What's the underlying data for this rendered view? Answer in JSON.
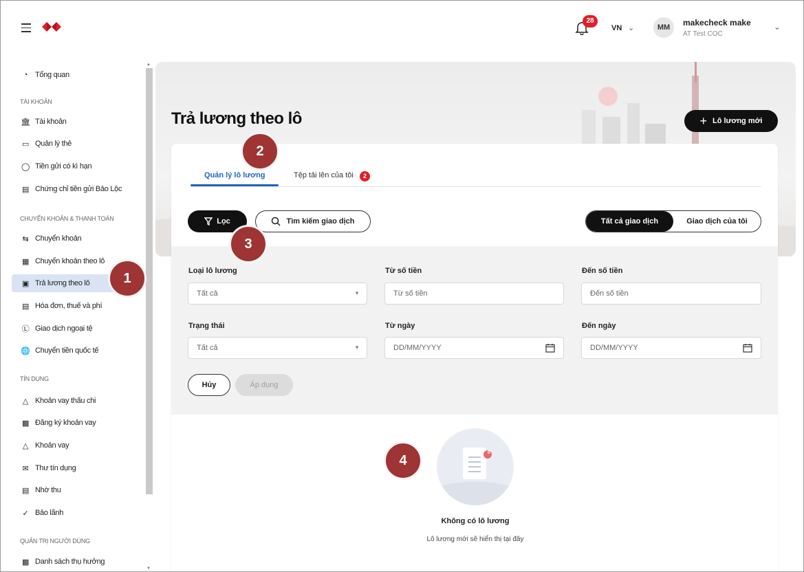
{
  "header": {
    "notifications_count": "28",
    "language": "VN",
    "avatar_initials": "MM",
    "user_name": "makecheck make",
    "user_org": "AT Test COC"
  },
  "sidebar": {
    "items": [
      {
        "label": "Tổng quan",
        "icon": "pie-chart-icon"
      },
      {
        "section": "TÀI KHOẢN"
      },
      {
        "label": "Tài khoản",
        "icon": "bank-icon"
      },
      {
        "label": "Quản lý thẻ",
        "icon": "card-icon"
      },
      {
        "label": "Tiền gửi có kì hạn",
        "icon": "piggy-icon"
      },
      {
        "label": "Chứng chỉ tiền gửi Bảo Lộc",
        "icon": "certificate-icon"
      },
      {
        "section": "CHUYỂN KHOẢN & THANH TOÁN"
      },
      {
        "label": "Chuyển khoản",
        "icon": "transfer-icon"
      },
      {
        "label": "Chuyển khoản theo lô",
        "icon": "table-icon"
      },
      {
        "label": "Trả lương theo lô",
        "icon": "calendar-icon",
        "active": true
      },
      {
        "label": "Hóa đơn, thuế và phí",
        "icon": "bill-icon"
      },
      {
        "label": "Giao dịch ngoại tệ",
        "icon": "fx-icon"
      },
      {
        "label": "Chuyển tiền quốc tế",
        "icon": "globe-icon"
      },
      {
        "section": "TÍN DỤNG"
      },
      {
        "label": "Khoản vay thấu chi",
        "icon": "money-bag-icon"
      },
      {
        "label": "Đăng ký khoản vay",
        "icon": "loan-register-icon"
      },
      {
        "label": "Khoản vay",
        "icon": "loan-icon"
      },
      {
        "label": "Thư tín dụng",
        "icon": "letter-icon"
      },
      {
        "label": "Nhờ thu",
        "icon": "collection-icon"
      },
      {
        "label": "Bảo lãnh",
        "icon": "guarantee-icon"
      },
      {
        "section": "QUẢN TRỊ NGƯỜI DÙNG"
      },
      {
        "label": "Danh sách thụ hưởng",
        "icon": "beneficiary-icon"
      }
    ]
  },
  "main": {
    "title": "Trả lương theo lô",
    "new_batch_label": "Lô lương mới",
    "tabs": [
      {
        "label": "Quản lý lô lương"
      },
      {
        "label": "Tệp tải lên của tôi",
        "badge": "2"
      }
    ],
    "filter_label": "Lọc",
    "search_label": "Tìm kiếm giao dịch",
    "segments": [
      "Tất cả giao dịch",
      "Giao dịch của tôi"
    ],
    "filters": {
      "batch_type_label": "Loại lô lương",
      "batch_type_value": "Tất cả",
      "from_amount_label": "Từ số tiền",
      "from_amount_placeholder": "Từ số tiền",
      "to_amount_label": "Đến số tiền",
      "to_amount_placeholder": "Đến số tiền",
      "status_label": "Trạng thái",
      "status_value": "Tất cả",
      "from_date_label": "Từ ngày",
      "from_date_placeholder": "DD/MM/YYYY",
      "to_date_label": "Đến ngày",
      "to_date_placeholder": "DD/MM/YYYY",
      "cancel_label": "Hủy",
      "apply_label": "Áp dụng"
    },
    "empty": {
      "badge": "0",
      "title": "Không có lô lương",
      "subtitle": "Lô lương mới sẽ hiển thị tại đây"
    }
  },
  "callouts": [
    "1",
    "2",
    "3",
    "4"
  ],
  "colors": {
    "accent": "#1f63c6",
    "brand_red": "#e01f26",
    "callout": "#9e3434"
  }
}
